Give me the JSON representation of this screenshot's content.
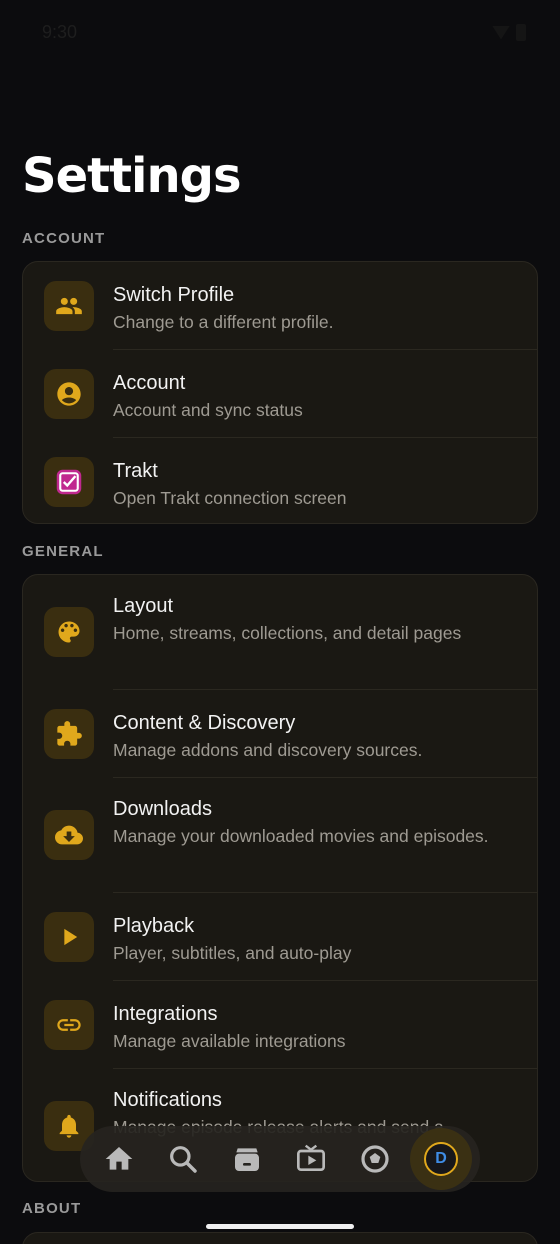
{
  "status_bar": {
    "time": "9:30"
  },
  "page_title": "Settings",
  "sections": [
    {
      "label": "ACCOUNT",
      "items": [
        {
          "icon": "people-icon",
          "title": "Switch Profile",
          "subtitle": "Change to a different profile."
        },
        {
          "icon": "account-circle-icon",
          "title": "Account",
          "subtitle": "Account and sync status"
        },
        {
          "icon": "trakt-icon",
          "title": "Trakt",
          "subtitle": "Open Trakt connection screen"
        }
      ]
    },
    {
      "label": "GENERAL",
      "items": [
        {
          "icon": "palette-icon",
          "title": "Layout",
          "subtitle": "Home, streams, collections, and detail pages"
        },
        {
          "icon": "puzzle-icon",
          "title": "Content & Discovery",
          "subtitle": "Manage addons and discovery sources."
        },
        {
          "icon": "cloud-download-icon",
          "title": "Downloads",
          "subtitle": "Manage your downloaded movies and episodes."
        },
        {
          "icon": "play-icon",
          "title": "Playback",
          "subtitle": "Player, subtitles, and auto-play"
        },
        {
          "icon": "link-icon",
          "title": "Integrations",
          "subtitle": "Manage available integrations"
        },
        {
          "icon": "bell-icon",
          "title": "Notifications",
          "subtitle": "Manage episode release alerts and send a"
        }
      ]
    },
    {
      "label": "ABOUT"
    }
  ],
  "bottom_nav": {
    "items": [
      "home-icon",
      "search-icon",
      "library-icon",
      "tv-icon",
      "discover-icon"
    ],
    "avatar_initial": "D"
  },
  "colors": {
    "accent": "#e0a81c",
    "icon_bg": "#3a2e10",
    "card_bg": "#1a1813",
    "trakt": "#c0288f"
  }
}
